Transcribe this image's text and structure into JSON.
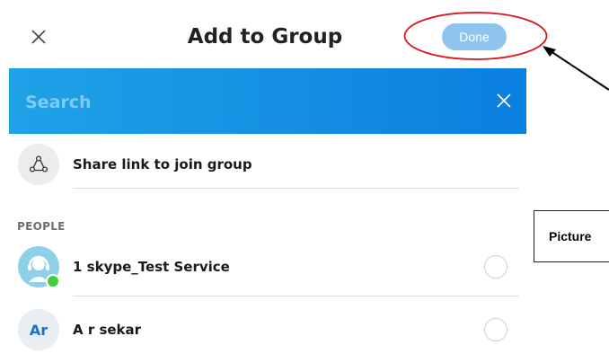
{
  "header": {
    "title": "Add to Group",
    "done_label": "Done",
    "close_icon": "close-icon"
  },
  "search": {
    "placeholder": "Search",
    "value": ""
  },
  "share_link": {
    "label": "Share link to join group",
    "icon": "share-link-icon"
  },
  "people": {
    "section_label": "PEOPLE",
    "contacts": [
      {
        "name": "1 skype_Test Service",
        "initials": "",
        "online": true,
        "selected": false
      },
      {
        "name": "A r sekar",
        "initials": "Ar",
        "online": false,
        "selected": false
      }
    ]
  },
  "annotation": {
    "label": "Picture",
    "ellipse_color": "#d9161c"
  },
  "colors": {
    "search_gradient_start": "#1fa2e6",
    "search_gradient_end": "#0b7fe0",
    "done_button": "#8ec4ee",
    "presence_online": "#3fcf3f"
  }
}
